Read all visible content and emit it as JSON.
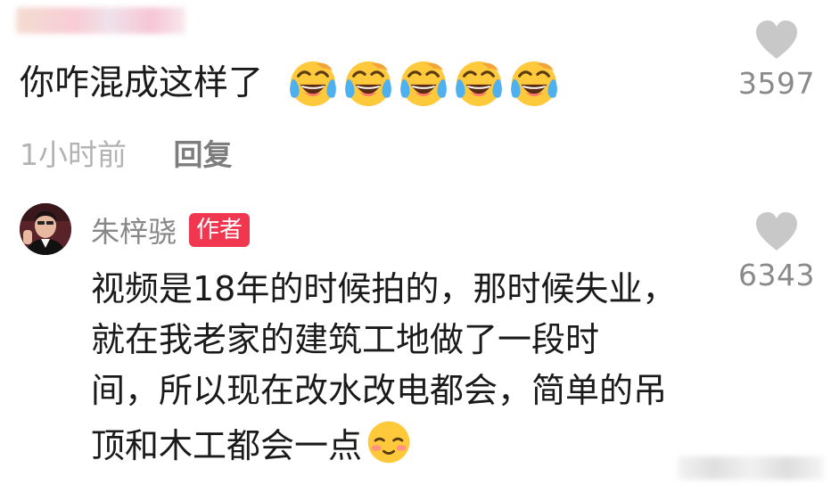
{
  "comment": {
    "text": "你咋混成这样了",
    "emoji_name": "laughing-crying-emoji",
    "emoji_count": 5,
    "like_count": "3597",
    "timestamp": "1小时前",
    "reply_label": "回复"
  },
  "reply": {
    "author": "朱梓骁",
    "badge": "作者",
    "lines": [
      "视频是18年的时候拍的，那时候失业，",
      "就在我老家的建筑工地做了一段时",
      "间，所以现在改水改电都会，简单的吊",
      "顶和木工都会一点"
    ],
    "end_emoji": "shy-smile-emoji",
    "like_count": "6343"
  },
  "icons": {
    "like": "heart-icon"
  },
  "colors": {
    "badge": "#f1364f",
    "heart": "#c8c8c8",
    "like_count": "#8a8a8a",
    "timestamp": "#b3b3b3",
    "reply_link": "#7d7d7d",
    "author": "#888888"
  }
}
